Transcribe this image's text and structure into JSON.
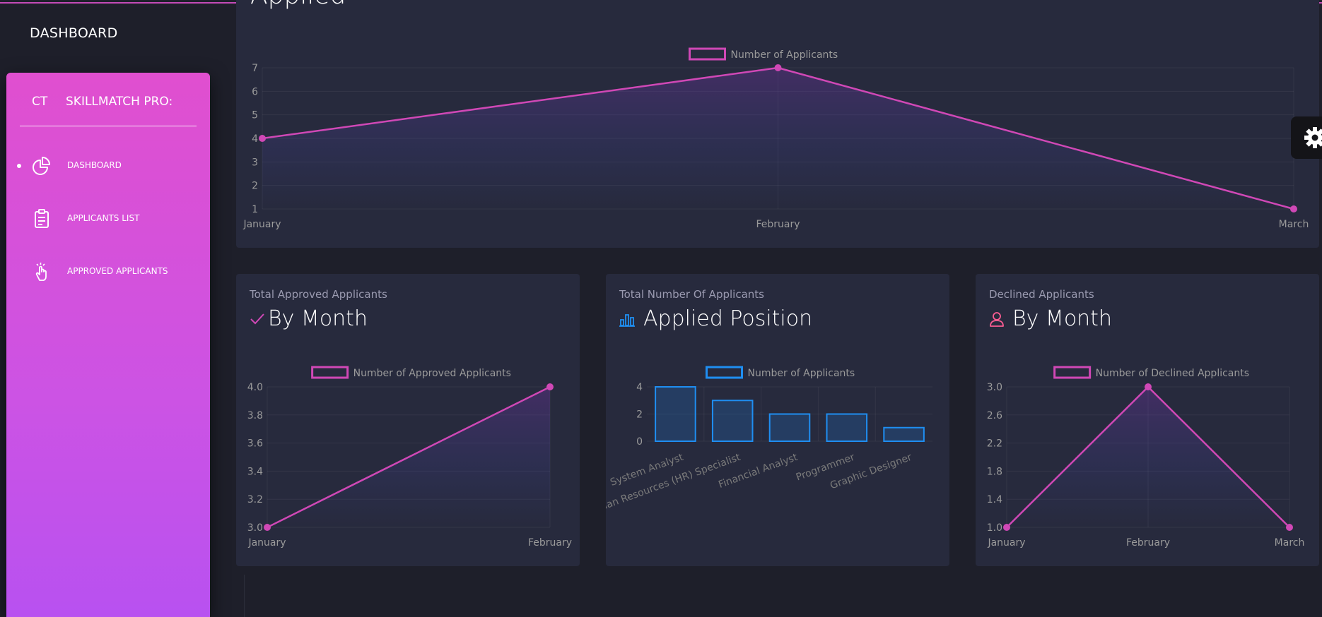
{
  "brand": {
    "title": "DASHBOARD"
  },
  "sidebar": {
    "mini": "CT",
    "name": "SKILLMATCH PRO:",
    "items": [
      {
        "label": "DASHBOARD",
        "icon": "pie-chart-icon",
        "active": true
      },
      {
        "label": "APPLICANTS LIST",
        "icon": "clipboard-icon",
        "active": false
      },
      {
        "label": "APPROVED APPLICANTS",
        "icon": "pointer-hand-icon",
        "active": false
      }
    ]
  },
  "colors": {
    "accent": "#d048b6",
    "blue": "#1f8ef1",
    "danger": "#fd5d93",
    "card": "#272a3d",
    "background": "#1e1f2a"
  },
  "cards": {
    "applied": {
      "title": "Applied"
    },
    "approved": {
      "category": "Total Approved Applicants",
      "title": "By Month",
      "icon": "check-icon"
    },
    "positions": {
      "category": "Total Number Of Applicants",
      "title": "Applied Position",
      "icon": "bar-chart-icon"
    },
    "declined": {
      "category": "Declined Applicants",
      "title": "By Month",
      "icon": "user-icon"
    }
  },
  "chart_data": [
    {
      "type": "area",
      "legend": "Number of Applicants",
      "categories": [
        "January",
        "February",
        "March"
      ],
      "values": [
        4,
        7,
        1
      ],
      "ylim": [
        1,
        7
      ],
      "yticks": [
        "7",
        "6",
        "5",
        "4",
        "3",
        "2",
        "1"
      ],
      "grid": true,
      "legend_position": "top-center"
    },
    {
      "type": "area",
      "legend": "Number of Approved Applicants",
      "categories": [
        "January",
        "February"
      ],
      "values": [
        3.0,
        4.0
      ],
      "ylim": [
        3.0,
        4.0
      ],
      "yticks": [
        "4.0",
        "3.8",
        "3.6",
        "3.4",
        "3.2",
        "3.0"
      ],
      "grid": true,
      "legend_position": "top-center"
    },
    {
      "type": "bar",
      "legend": "Number of Applicants",
      "categories": [
        "System Analyst",
        "Human Resources (HR) Specialist",
        "Financial Analyst",
        "Programmer",
        "Graphic Designer"
      ],
      "values": [
        4,
        3,
        2,
        2,
        1
      ],
      "ylim": [
        0,
        4
      ],
      "yticks": [
        "4",
        "2",
        "0"
      ],
      "grid": true,
      "legend_position": "top-center"
    },
    {
      "type": "area",
      "legend": "Number of Declined Applicants",
      "categories": [
        "January",
        "February",
        "March"
      ],
      "values": [
        1.0,
        3.0,
        1.0
      ],
      "ylim": [
        1.0,
        3.0
      ],
      "yticks": [
        "3.0",
        "2.6",
        "2.2",
        "1.8",
        "1.4",
        "1.0"
      ],
      "grid": true,
      "legend_position": "top-center"
    }
  ]
}
